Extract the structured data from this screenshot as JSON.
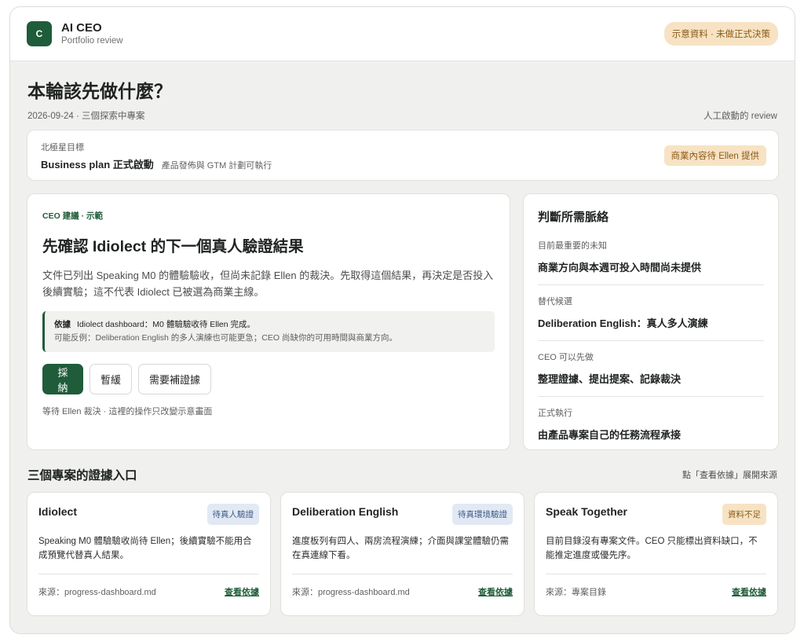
{
  "header": {
    "logo_letter": "C",
    "app_name": "AI CEO",
    "app_sub": "Portfolio review",
    "demo_badge": "示意資料 · 未做正式決策"
  },
  "page": {
    "title": "本輪該先做什麼？",
    "meta": "2026-09-24 · 三個探索中專案",
    "review_note": "人工啟動的 review"
  },
  "north_star": {
    "label": "北極星目標",
    "main": "Business plan 正式啟動",
    "sub": "產品發佈與 GTM 計劃可執行",
    "badge": "商業內容待 Ellen 提供"
  },
  "recommendation": {
    "kicker": "CEO 建議 · 示範",
    "title": "先確認 Idiolect 的下一個真人驗證結果",
    "body": "文件已列出 Speaking M0 的體驗驗收，但尚未記錄 Ellen 的裁決。先取得這個結果，再決定是否投入後續實驗；這不代表 Idiolect 已被選為商業主線。",
    "basis_key": "依據",
    "basis_text": "Idiolect dashboard：M0 體驗驗收待 Ellen 完成。",
    "counter": "可能反例：Deliberation English 的多人演練也可能更急；CEO 尚缺你的可用時間與商業方向。",
    "actions": {
      "accept": "採納",
      "defer": "暫緩",
      "need_evidence": "需要補證據"
    },
    "footnote": "等待 Ellen 裁決 · 這裡的操作只改變示意畫面"
  },
  "context": {
    "title": "判斷所需脈絡",
    "items": [
      {
        "label": "目前最重要的未知",
        "value": "商業方向與本週可投入時間尚未提供"
      },
      {
        "label": "替代候選",
        "value": "Deliberation English：真人多人演練"
      },
      {
        "label": "CEO 可以先做",
        "value": "整理證據、提出提案、記錄裁決"
      },
      {
        "label": "正式執行",
        "value": "由產品專案自己的任務流程承接"
      }
    ]
  },
  "projects": {
    "title": "三個專案的證據入口",
    "hint": "點「查看依據」展開來源",
    "items": [
      {
        "name": "Idiolect",
        "badge": "待真人驗證",
        "desc": "Speaking M0 體驗驗收尚待 Ellen；後續實驗不能用合成預覽代替真人結果。",
        "source": "來源：progress-dashboard.md",
        "link": "查看依據"
      },
      {
        "name": "Deliberation English",
        "badge": "待真環境驗證",
        "desc": "進度板列有四人、兩房流程演練；介面與課堂體驗仍需在真連線下看。",
        "source": "來源：progress-dashboard.md",
        "link": "查看依據"
      },
      {
        "name": "Speak Together",
        "badge": "資料不足",
        "desc": "目前目錄沒有專案文件。CEO 只能標出資料缺口，不能推定進度或優先序。",
        "source": "來源：專案目錄",
        "link": "查看依據"
      }
    ]
  },
  "colors": {
    "brand_green": "#1f5c3a",
    "amber_badge_bg": "#f7e3c4",
    "blue_badge_bg": "#e2e9f4",
    "page_bg": "#f0f0ee"
  }
}
